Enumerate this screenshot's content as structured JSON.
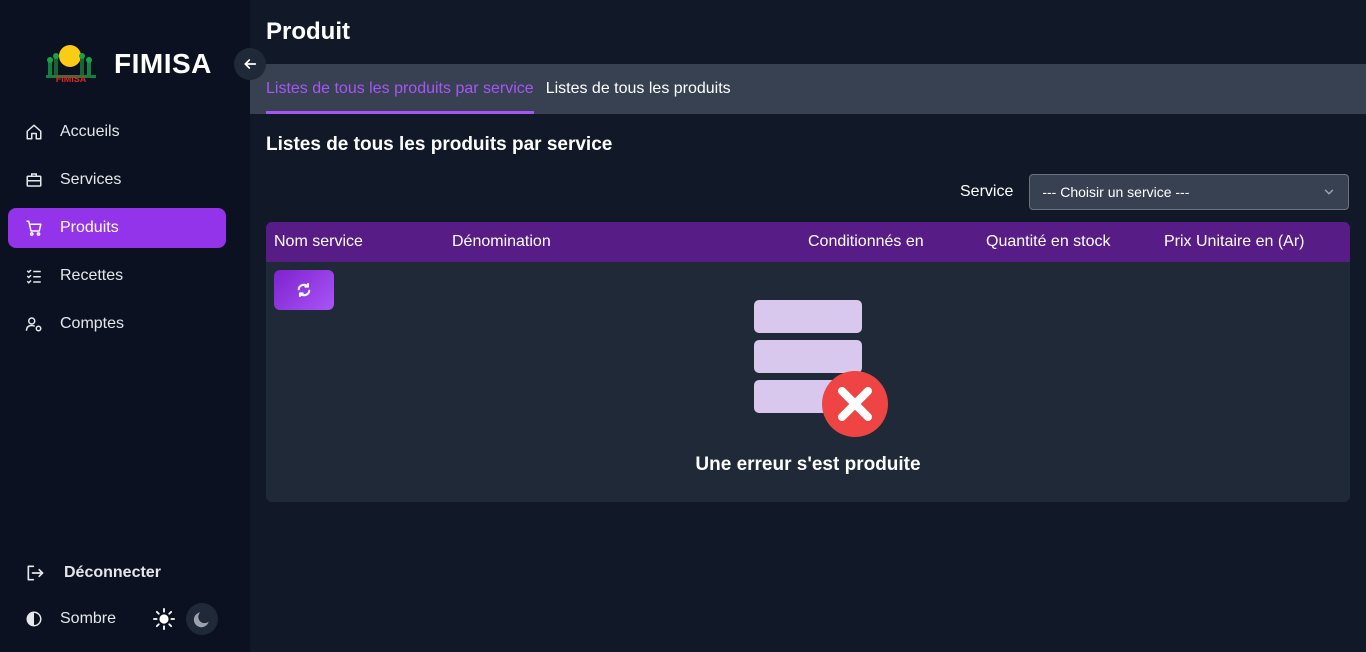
{
  "brand": {
    "name": "FIMISA",
    "logo_text": "FIMISA"
  },
  "sidebar": {
    "items": [
      {
        "label": "Accueils",
        "icon": "home-icon"
      },
      {
        "label": "Services",
        "icon": "briefcase-icon"
      },
      {
        "label": "Produits",
        "icon": "cart-icon",
        "active": true
      },
      {
        "label": "Recettes",
        "icon": "checklist-icon"
      },
      {
        "label": "Comptes",
        "icon": "user-settings-icon"
      }
    ],
    "logout_label": "Déconnecter",
    "theme_label": "Sombre"
  },
  "page": {
    "title": "Produit",
    "tabs": [
      {
        "label": "Listes de tous les produits par service",
        "active": true
      },
      {
        "label": "Listes de tous les produits",
        "active": false
      }
    ],
    "section_title": "Listes de tous les produits par service",
    "filter": {
      "label": "Service",
      "select_value": "--- Choisir un service ---"
    },
    "table": {
      "columns": [
        "Nom service",
        "Dénomination",
        "Conditionnés en",
        "Quantité en stock",
        "Prix Unitaire en (Ar)"
      ]
    },
    "error_message": "Une erreur s'est produite"
  },
  "colors": {
    "accent": "#9333ea",
    "tab_active": "#a855f7",
    "table_header": "#581c87",
    "error_red": "#ef4444",
    "illustration": "#d8c8ee"
  }
}
